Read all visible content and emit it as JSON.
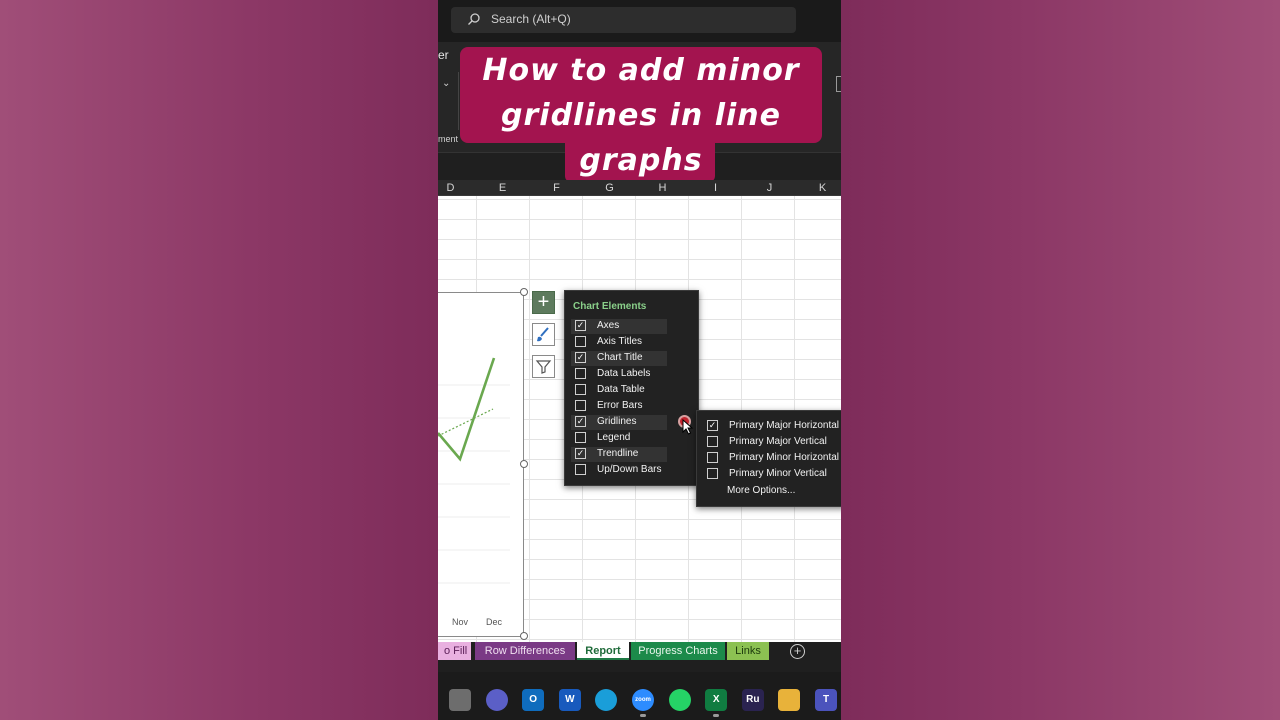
{
  "search": {
    "placeholder": "Search (Alt+Q)"
  },
  "ribbon": {
    "tab_fragment": "er",
    "group_fragment": "ment",
    "caret": "⌄"
  },
  "banner": {
    "line1": "How to add minor",
    "line2": "gridlines in line",
    "line3": "graphs"
  },
  "columns": [
    "D",
    "E",
    "F",
    "G",
    "H",
    "I",
    "J",
    "K"
  ],
  "chart": {
    "x_labels": [
      "Nov",
      "Dec"
    ]
  },
  "chart_elements": {
    "title": "Chart Elements",
    "items": [
      {
        "label": "Axes",
        "checked": true
      },
      {
        "label": "Axis Titles",
        "checked": false
      },
      {
        "label": "Chart Title",
        "checked": true
      },
      {
        "label": "Data Labels",
        "checked": false
      },
      {
        "label": "Data Table",
        "checked": false
      },
      {
        "label": "Error Bars",
        "checked": false
      },
      {
        "label": "Gridlines",
        "checked": true
      },
      {
        "label": "Legend",
        "checked": false
      },
      {
        "label": "Trendline",
        "checked": true
      },
      {
        "label": "Up/Down Bars",
        "checked": false
      }
    ]
  },
  "gridlines_submenu": {
    "items": [
      {
        "label": "Primary Major Horizontal",
        "checked": true
      },
      {
        "label": "Primary Major Vertical",
        "checked": false
      },
      {
        "label": "Primary Minor Horizontal",
        "checked": false
      },
      {
        "label": "Primary Minor Vertical",
        "checked": false
      }
    ],
    "more": "More Options..."
  },
  "sheet_tabs": [
    "o Fill",
    "Row Differences",
    "Report",
    "Progress Charts",
    "Links"
  ],
  "active_sheet": "Report",
  "taskbar": [
    {
      "name": "file-explorer-icon",
      "color": "#6d6d6d",
      "text": ""
    },
    {
      "name": "teams-meet-icon",
      "color": "#5b5fc7",
      "text": ""
    },
    {
      "name": "outlook-icon",
      "color": "#0f6cbd",
      "text": "O"
    },
    {
      "name": "word-icon",
      "color": "#185abd",
      "text": "W"
    },
    {
      "name": "edge-icon",
      "color": "#1a9ed9",
      "text": ""
    },
    {
      "name": "zoom-icon",
      "color": "#2d8cff",
      "text": "zoom"
    },
    {
      "name": "whatsapp-icon",
      "color": "#25d366",
      "text": ""
    },
    {
      "name": "excel-icon",
      "color": "#107c41",
      "text": "X"
    },
    {
      "name": "rush-icon",
      "color": "#2a2350",
      "text": "Ru"
    },
    {
      "name": "folder-icon",
      "color": "#e8b23a",
      "text": ""
    },
    {
      "name": "teams-icon",
      "color": "#4b53bc",
      "text": "T"
    }
  ]
}
